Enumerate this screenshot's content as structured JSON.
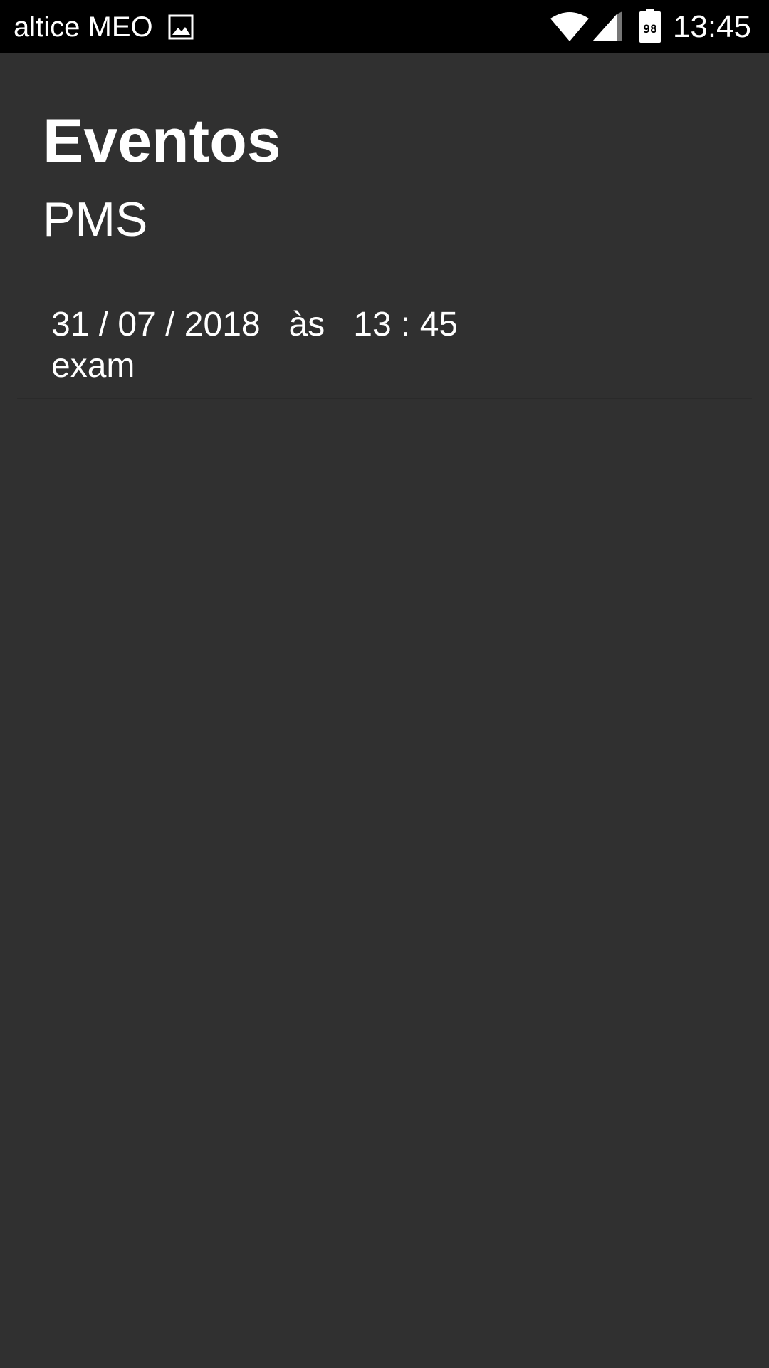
{
  "status_bar": {
    "carrier": "altice MEO",
    "battery_level": "98",
    "time": "13:45",
    "icons": [
      "gallery-icon",
      "wifi-icon",
      "cellular-signal-icon",
      "battery-icon"
    ]
  },
  "header": {
    "title": "Eventos",
    "subtitle": "PMS"
  },
  "events": [
    {
      "datetime": "31 / 07 / 2018   às   13 : 45",
      "name": "exam"
    }
  ],
  "colors": {
    "background": "#303030",
    "status_bar": "#000000",
    "text": "#ffffff",
    "divider": "#2a2a2a"
  }
}
